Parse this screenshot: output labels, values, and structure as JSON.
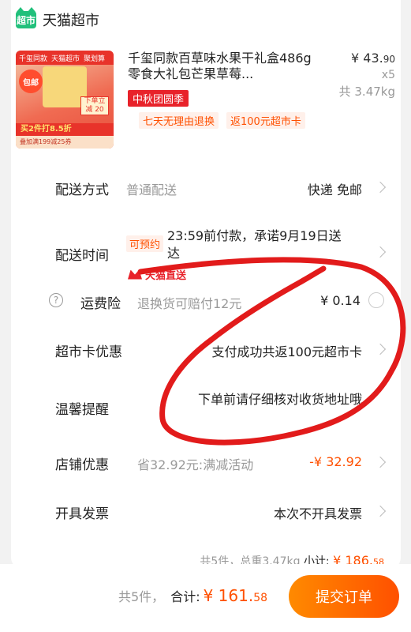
{
  "store": {
    "logo": "超市",
    "name": "天猫超市"
  },
  "product": {
    "title": "千玺同款百草味水果干礼盒486g零食大礼包芒果草莓...",
    "price_main": "¥ 43.",
    "price_decimal": "90",
    "qty": "x5",
    "weight": "共 3.47kg",
    "tag_event": "中秋团圆季",
    "tag_return": "七天无理由退换",
    "tag_card": "返100元超市卡",
    "image": {
      "top_1": "千玺同款",
      "top_2": "天猫超市",
      "top_3": "聚划算",
      "badge": "包邮",
      "price_tag": "下单立减 20",
      "banner": "买2件打8.5折",
      "bottom": "叠加满199减25券"
    }
  },
  "rows": {
    "shipping": {
      "label": "配送方式",
      "sub": "普通配送",
      "value": "快递 免邮"
    },
    "delivery_time": {
      "label": "配送时间",
      "tag": "可预约",
      "text": "23:59前付款，承诺9月19日送达",
      "direct": "天猫直送"
    },
    "insurance": {
      "label": "运费险",
      "help": "?",
      "sub": "退换货可赔付12元",
      "value": "¥ 0.14"
    },
    "card_offer": {
      "label": "超市卡优惠",
      "value": "支付成功共返100元超市卡"
    },
    "reminder": {
      "label": "温馨提醒",
      "value": "下单前请仔细核对收货地址哦"
    },
    "store_discount": {
      "label": "店铺优惠",
      "sub": "省32.92元:满减活动",
      "value": "-¥ 32.92"
    },
    "invoice": {
      "label": "开具发票",
      "value": "本次不开具发票"
    }
  },
  "summary": {
    "text": "共5件，总重3.47kg",
    "label": "小计:",
    "amount_main": "¥ 186.",
    "amount_decimal": "58"
  },
  "bottom": {
    "count": "共5件，",
    "label": "合计:",
    "total_main": "¥ 161.",
    "total_decimal": "58",
    "submit": "提交订单"
  },
  "colors": {
    "accent": "#ff5000",
    "brand_red": "#e8222a",
    "store_green": "#21c07b",
    "scribble": "#e21b1b"
  }
}
